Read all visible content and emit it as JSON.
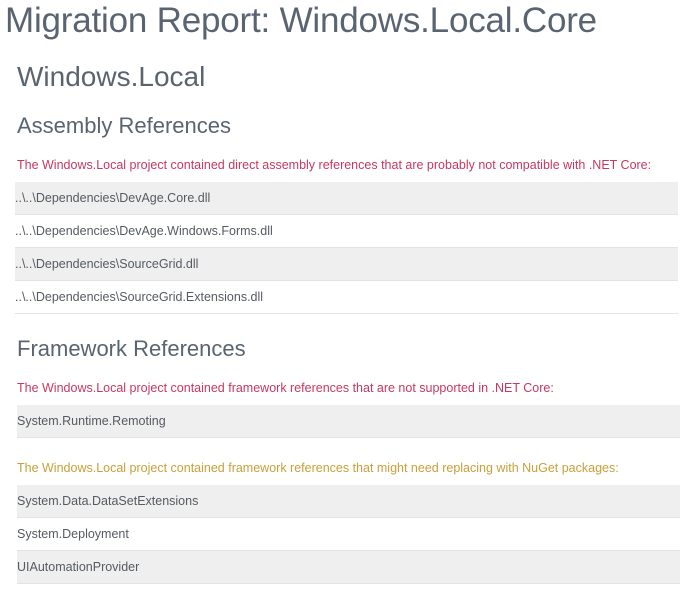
{
  "report": {
    "title": "Migration Report: Windows.Local.Core"
  },
  "project": {
    "name": "Windows.Local"
  },
  "assembly_references": {
    "heading": "Assembly References",
    "notice": "The Windows.Local project contained direct assembly references that are probably not compatible with .NET Core:",
    "items": [
      "..\\..\\Dependencies\\DevAge.Core.dll",
      "..\\..\\Dependencies\\DevAge.Windows.Forms.dll",
      "..\\..\\Dependencies\\SourceGrid.dll",
      "..\\..\\Dependencies\\SourceGrid.Extensions.dll"
    ]
  },
  "framework_references": {
    "heading": "Framework References",
    "unsupported_notice": "The Windows.Local project contained framework references that are not supported in .NET Core:",
    "unsupported_items": [
      "System.Runtime.Remoting"
    ],
    "replace_notice": "The Windows.Local project contained framework references that might need replacing with NuGet packages:",
    "replace_items": [
      "System.Data.DataSetExtensions",
      "System.Deployment",
      "UIAutomationProvider"
    ]
  },
  "colors": {
    "danger": "#c9385f",
    "warning": "#c9a03a",
    "heading": "#5a6470",
    "row_alt": "#efefef"
  }
}
